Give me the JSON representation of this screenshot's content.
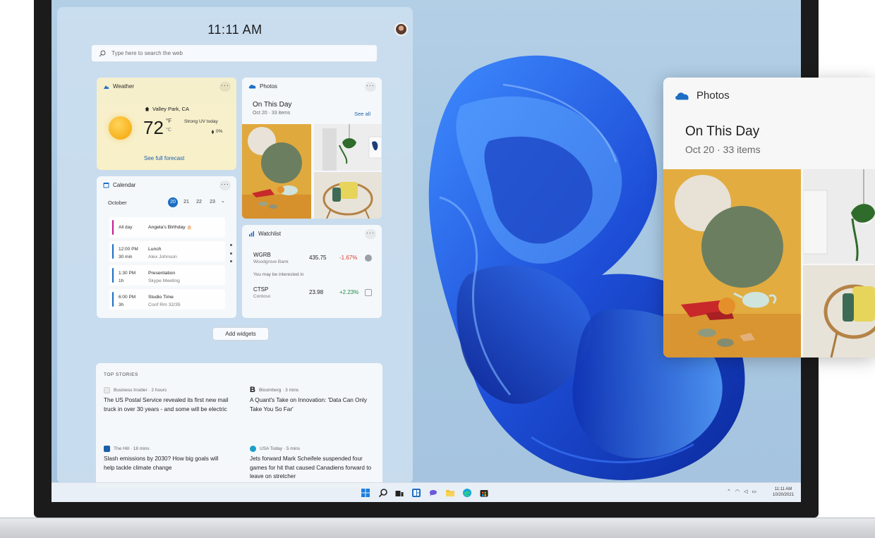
{
  "colors": {
    "accent": "#1b6ec2",
    "positive": "#1a8a3c",
    "negative": "#d83b2a",
    "wallpaper_blue": "#1e4fd8"
  },
  "panel": {
    "clock": "11:11 AM",
    "search_placeholder": "Type here to search the web"
  },
  "weather": {
    "title": "Weather",
    "location": "Valley Park, CA",
    "temp": "72",
    "unit_f": "°F",
    "unit_c": "°C",
    "uv": "Strong UV today",
    "precip": "0%",
    "forecast_link": "See full forecast",
    "icon": "sun-icon"
  },
  "photos": {
    "title": "Photos",
    "heading": "On This Day",
    "sub": "Oct 20 · 33 items",
    "see_all": "See all"
  },
  "calendar": {
    "title": "Calendar",
    "month": "October",
    "days": [
      "20",
      "21",
      "22",
      "23"
    ],
    "events": [
      {
        "time": "All day",
        "duration": "",
        "title": "Angela's Birthday",
        "sub": "",
        "color": "#c2188a"
      },
      {
        "time": "12:00 PM",
        "duration": "30 min",
        "title": "Lunch",
        "sub": "Alex Johnson",
        "color": "#1b6ec2"
      },
      {
        "time": "1:30 PM",
        "duration": "1h",
        "title": "Presentation",
        "sub": "Skype Meeting",
        "color": "#1b6ec2"
      },
      {
        "time": "6:00 PM",
        "duration": "3h",
        "title": "Studio Time",
        "sub": "Conf Rm 32/35",
        "color": "#1b6ec2"
      }
    ]
  },
  "watchlist": {
    "title": "Watchlist",
    "stocks": [
      {
        "symbol": "WGRB",
        "name": "Woodgrove Bank",
        "price": "435.75",
        "change": "-1.67%"
      },
      {
        "symbol": "CTSP",
        "name": "Contoso",
        "price": "23.98",
        "change": "+2.23%"
      }
    ],
    "hint": "You may be interested in"
  },
  "add_widgets": "Add widgets",
  "stories": {
    "heading": "TOP STORIES",
    "items": [
      {
        "source": "Business Insider · 2 hours",
        "headline": "The US Postal Service revealed its first new mail truck in over 30 years - and some will be electric",
        "icon_color": "#e8e8e8"
      },
      {
        "source": "Bloomberg · 3 mins",
        "headline": "A Quant's Take on Innovation: 'Data Can Only Take You So Far'",
        "icon_color": "#111111"
      },
      {
        "source": "The Hill · 18 mins",
        "headline": "Slash emissions by 2030? How big goals will help tackle climate change",
        "icon_color": "#1b5fa8"
      },
      {
        "source": "USA Today · 5 mins",
        "headline": "Jets forward Mark Scheifele suspended four games for hit that caused Canadiens forward to leave on stretcher",
        "icon_color": "#1aa0c8"
      }
    ]
  },
  "taskbar": {
    "clock_time": "11:11 AM",
    "clock_date": "10/20/2021",
    "icons": [
      "windows-start-icon",
      "search-icon",
      "task-view-icon",
      "widgets-icon",
      "chat-icon",
      "file-explorer-icon",
      "edge-icon",
      "store-icon"
    ]
  },
  "flyout": {
    "app": "Photos",
    "heading": "On This Day",
    "sub": "Oct 20 · 33 items"
  }
}
